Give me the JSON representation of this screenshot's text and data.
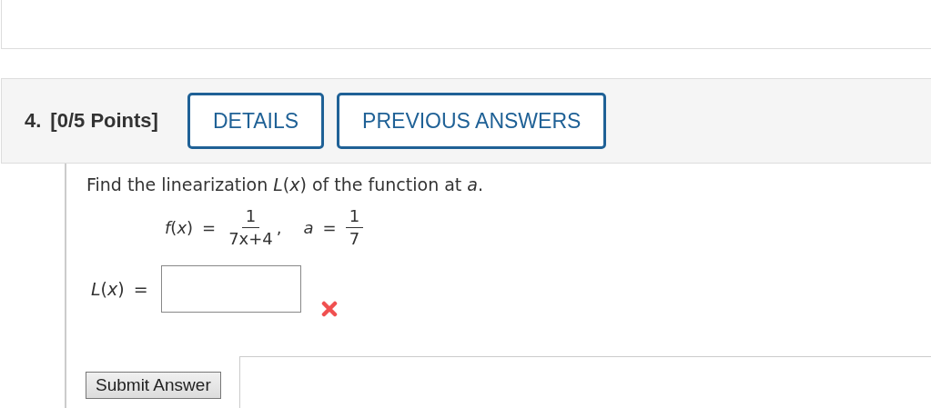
{
  "question": {
    "number": "4.",
    "points": "[0/5 Points]",
    "buttons": [
      {
        "label": "DETAILS"
      },
      {
        "label": "PREVIOUS ANSWERS"
      }
    ]
  },
  "prompt": "Find the linearization *L*(*x*) of the function at *a*.",
  "formula": {
    "lhs": "*f*(*x*)",
    "equals": "=",
    "numerator": "1",
    "denominator": "7x+4",
    "separator": ",",
    "param": "*a*",
    "param_equals": "=",
    "param_numerator": "1",
    "param_denominator": "7"
  },
  "answer": {
    "label": "*L*(*x*)",
    "equals": "=",
    "correct": false
  },
  "submit": {
    "label": "Submit Answer"
  }
}
